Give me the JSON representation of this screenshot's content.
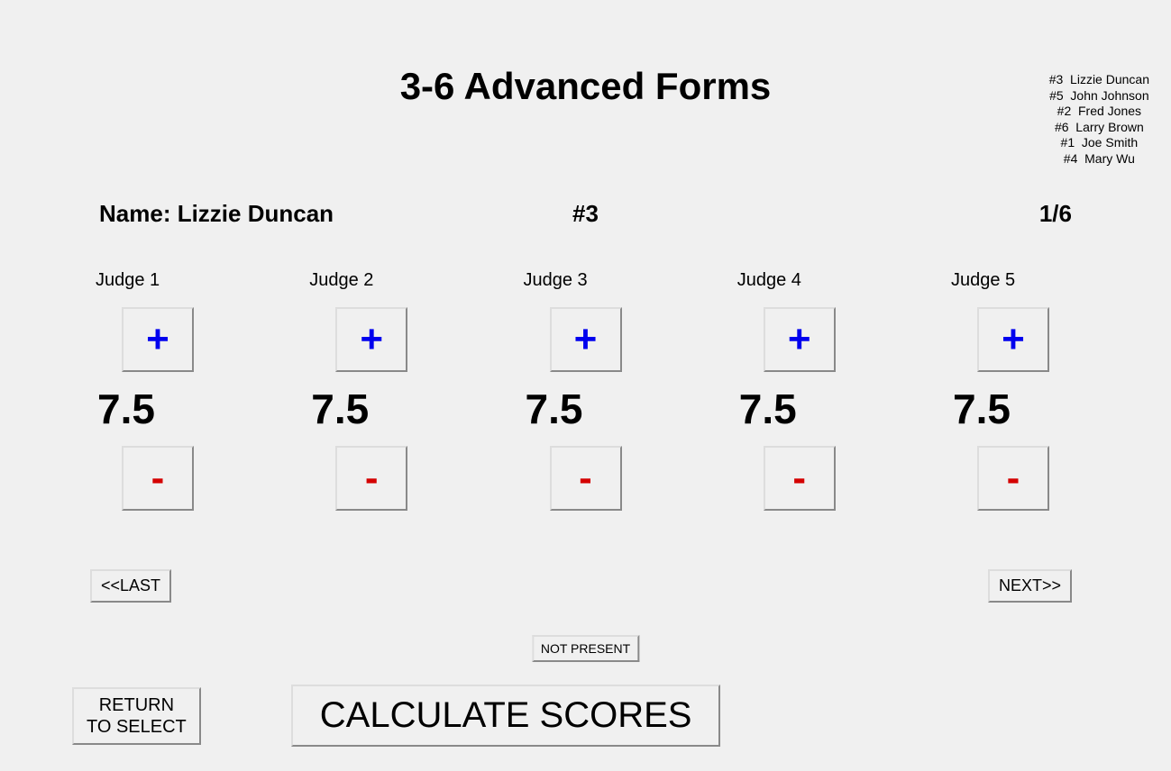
{
  "title": "3-6 Advanced Forms",
  "roster": [
    "#3  Lizzie Duncan",
    "#5  John Johnson",
    "#2  Fred Jones",
    "#6  Larry Brown",
    "#1  Joe Smith",
    "#4  Mary Wu"
  ],
  "competitor": {
    "name_label": "Name: Lizzie Duncan",
    "number": "#3",
    "progress": "1/6"
  },
  "judges": [
    {
      "label": "Judge 1",
      "score": "7.5"
    },
    {
      "label": "Judge 2",
      "score": "7.5"
    },
    {
      "label": "Judge 3",
      "score": "7.5"
    },
    {
      "label": "Judge 4",
      "score": "7.5"
    },
    {
      "label": "Judge 5",
      "score": "7.5"
    }
  ],
  "symbols": {
    "plus": "+",
    "minus": "-"
  },
  "nav": {
    "last": "<<LAST",
    "next": "NEXT>>"
  },
  "buttons": {
    "not_present": "NOT PRESENT",
    "return": "RETURN\nTO SELECT",
    "calculate": "CALCULATE SCORES"
  }
}
